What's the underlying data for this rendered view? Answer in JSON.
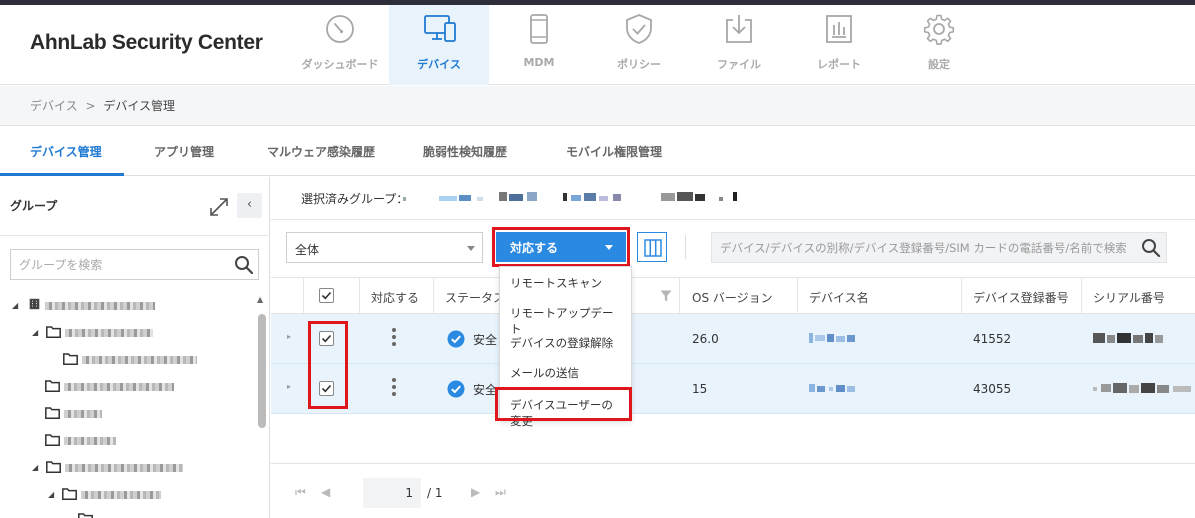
{
  "app": {
    "brand": "AhnLab Security Center"
  },
  "nav": [
    {
      "label": "ダッシュボード",
      "icon": "dashboard-gauge-icon",
      "active": false
    },
    {
      "label": "デバイス",
      "icon": "devices-icon",
      "active": true
    },
    {
      "label": "MDM",
      "icon": "mobile-phone-icon",
      "active": false
    },
    {
      "label": "ポリシー",
      "icon": "shield-check-icon",
      "active": false
    },
    {
      "label": "ファイル",
      "icon": "download-tray-icon",
      "active": false
    },
    {
      "label": "レポート",
      "icon": "report-chart-icon",
      "active": false
    },
    {
      "label": "設定",
      "icon": "gear-icon",
      "active": false
    }
  ],
  "breadcrumb": {
    "parent": "デバイス",
    "separator": ">",
    "current": "デバイス管理"
  },
  "subtabs": [
    {
      "label": "デバイス管理",
      "active": true
    },
    {
      "label": "アプリ管理",
      "active": false
    },
    {
      "label": "マルウェア感染履歴",
      "active": false
    },
    {
      "label": "脆弱性検知履歴",
      "active": false
    },
    {
      "label": "モバイル権限管理",
      "active": false
    }
  ],
  "left_panel": {
    "title": "グループ",
    "search_placeholder": "グループを検索",
    "collapse_glyph": "‹"
  },
  "main": {
    "selected_group_label": "選択済みグループ：",
    "filter_value": "全体",
    "action_button_label": "対応する",
    "search_placeholder": "デバイス/デバイスの別称/デバイス登録番号/SIM カードの電話番号/名前で検索"
  },
  "table": {
    "headers": {
      "action": "対応する",
      "status": "ステータス",
      "os_version": "OS バージョン",
      "device_name": "デバイス名",
      "reg_no": "デバイス登録番号",
      "serial": "シリアル番号"
    },
    "rows": [
      {
        "checked": true,
        "status": "安全",
        "os_version": "26.0",
        "reg_no": "41552"
      },
      {
        "checked": true,
        "status": "安全",
        "os_version": "15",
        "reg_no": "43055"
      }
    ]
  },
  "action_menu": {
    "items": [
      "リモートスキャン",
      "リモートアップデート",
      "デバイスの登録解除",
      "メールの送信",
      "デバイスユーザーの変更"
    ]
  },
  "pagination": {
    "current_page": "1",
    "total": "/ 1"
  },
  "colors": {
    "accent": "#1f7ad3",
    "action_button": "#2a8ae2",
    "row_selected": "#e9f3fc",
    "highlight_outline": "#e0161d",
    "status_safe": "#2a8ae2"
  }
}
